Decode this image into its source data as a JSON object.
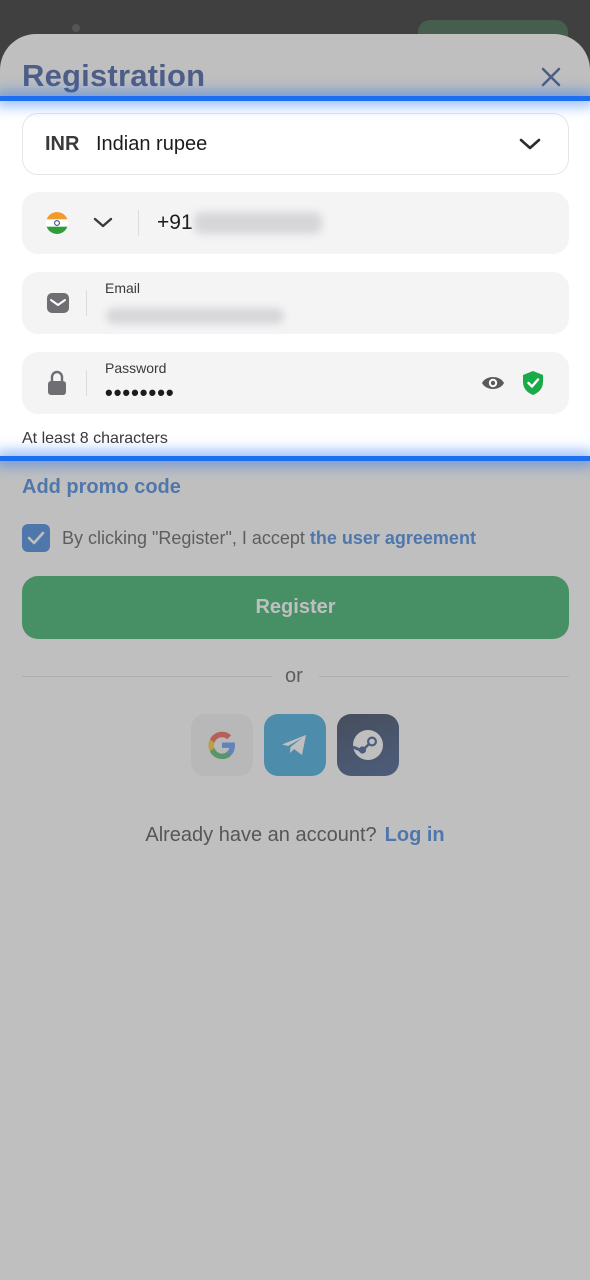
{
  "header": {
    "title": "Registration"
  },
  "currency": {
    "code": "INR",
    "name": "Indian rupee"
  },
  "phone": {
    "country": "India",
    "dial_code": "+91"
  },
  "email": {
    "label": "Email"
  },
  "password": {
    "label": "Password",
    "value": "••••••••",
    "hint": "At least 8 characters"
  },
  "promo": {
    "label": "Add promo code"
  },
  "agreement": {
    "prefix": "By clicking \"Register\", I accept ",
    "link": "the user agreement",
    "checked": true
  },
  "register": {
    "label": "Register"
  },
  "divider": {
    "text": "or"
  },
  "social": {
    "buttons": [
      "google-icon",
      "telegram-icon",
      "steam-icon"
    ]
  },
  "login": {
    "prompt": "Already have an account?",
    "link": "Log in"
  },
  "colors": {
    "brand_blue": "#1f6fd6",
    "title_blue": "#1a3d8f",
    "register_green": "#0fa14b",
    "shield_green": "#1aaa4a"
  }
}
